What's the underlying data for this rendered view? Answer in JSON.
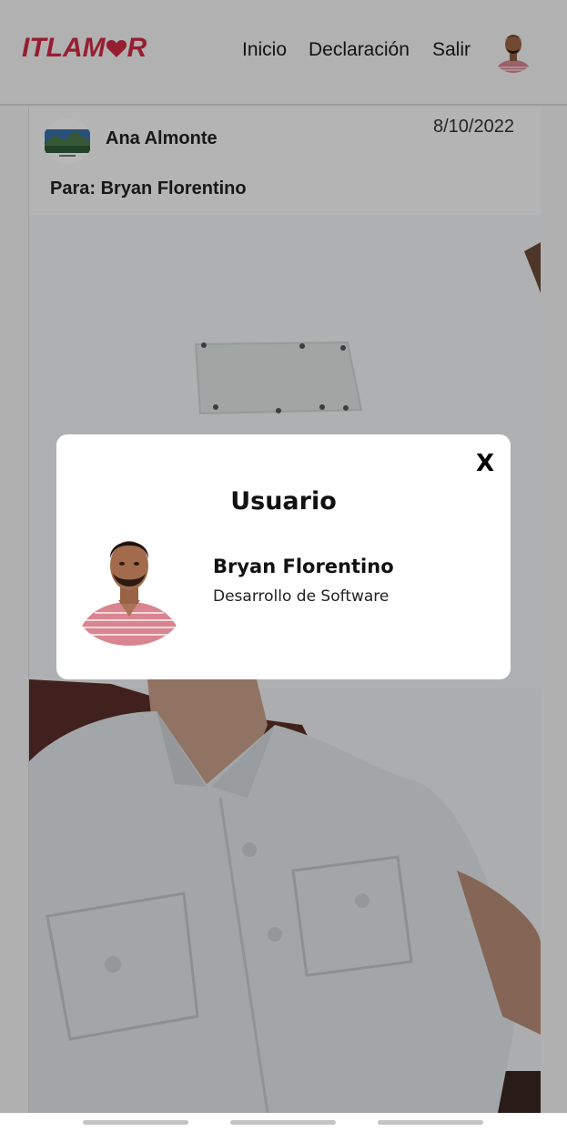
{
  "navbar": {
    "logo_prefix": "ITLAM",
    "logo_suffix": "R",
    "links": {
      "home": "Inicio",
      "declaration": "Declaración",
      "logout": "Salir"
    },
    "brand_color": "#d02a44"
  },
  "post": {
    "sender_name": "Ana Almonte",
    "date": "8/10/2022",
    "recipient": "Para: Bryan Florentino"
  },
  "modal": {
    "close_label": "X",
    "title": "Usuario",
    "user_name": "Bryan Florentino",
    "user_role": "Desarrollo de Software"
  }
}
